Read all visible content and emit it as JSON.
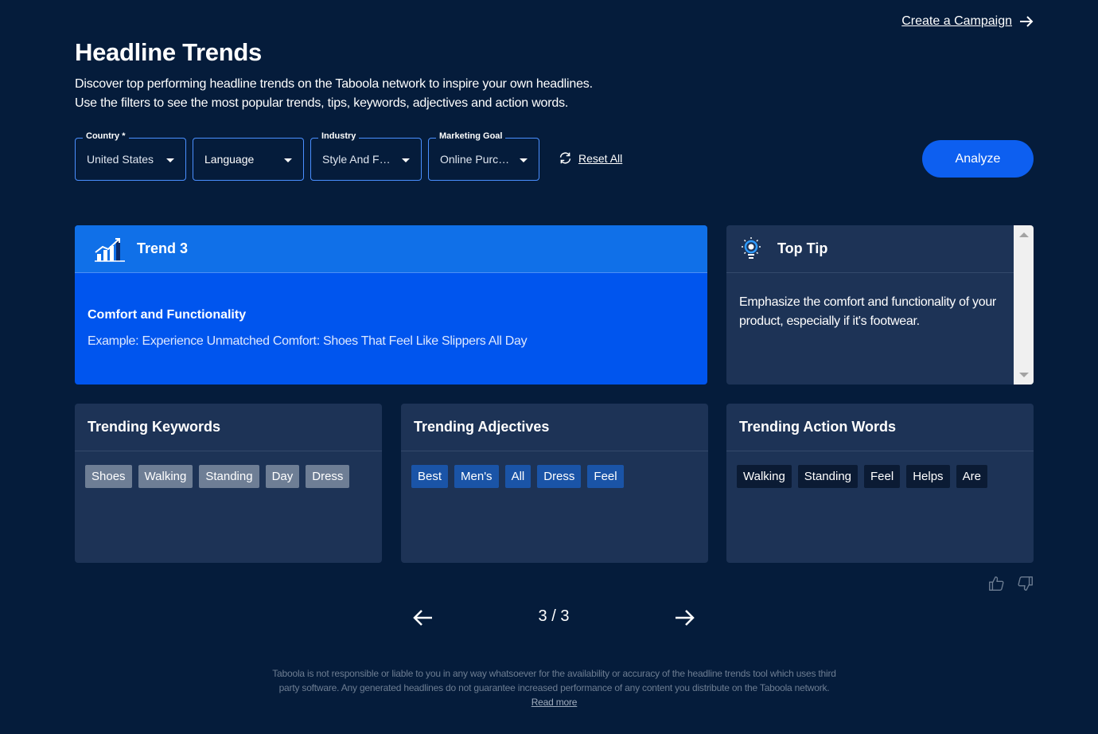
{
  "header": {
    "create_campaign": "Create a Campaign",
    "title": "Headline Trends",
    "description_line1": "Discover top performing headline trends on the Taboola network to inspire your own headlines.",
    "description_line2": "Use the filters to see the most popular trends, tips, keywords, adjectives and action words."
  },
  "filters": {
    "country": {
      "label": "Country *",
      "value": "United States"
    },
    "language": {
      "value": "Language"
    },
    "industry": {
      "label": "Industry",
      "value": "Style And F…"
    },
    "goal": {
      "label": "Marketing Goal",
      "value": "Online Purc…"
    },
    "reset": "Reset All",
    "analyze": "Analyze"
  },
  "trend": {
    "title": "Trend 3",
    "name": "Comfort and Functionality",
    "example": "Example: Experience Unmatched Comfort: Shoes That Feel Like Slippers All Day",
    "icon": "chart-growth-icon"
  },
  "tip": {
    "title": "Top Tip",
    "text": "Emphasize the comfort and functionality of your product, especially if it's footwear.",
    "icon": "lightbulb-icon"
  },
  "keywords": {
    "title": "Trending Keywords",
    "items": [
      "Shoes",
      "Walking",
      "Standing",
      "Day",
      "Dress"
    ]
  },
  "adjectives": {
    "title": "Trending Adjectives",
    "items": [
      "Best",
      "Men's",
      "All",
      "Dress",
      "Feel"
    ]
  },
  "actions": {
    "title": "Trending Action Words",
    "items": [
      "Walking",
      "Standing",
      "Feel",
      "Helps",
      "Are"
    ]
  },
  "pager": {
    "text": "3 / 3"
  },
  "disclaimer": {
    "text": "Taboola is not responsible or liable to you in any way whatsoever for the availability or accuracy of the headline trends tool which uses third party software. Any generated headlines do not guarantee increased performance of any content you distribute on the Taboola network.",
    "read_more": "Read more"
  },
  "colors": {
    "background": "#051c3b",
    "card": "#1d3356",
    "accent": "#0d5ff0",
    "trend_card": "#0055ee"
  }
}
